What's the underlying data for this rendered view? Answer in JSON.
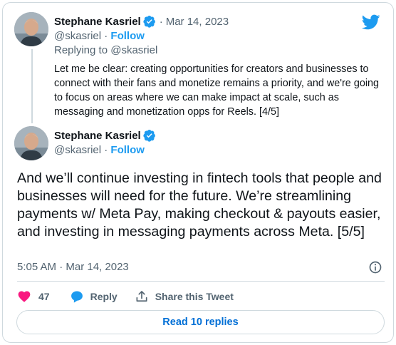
{
  "colors": {
    "accent": "#1d9bf0",
    "text": "#0f1419",
    "secondary": "#536471",
    "like": "#f91880",
    "border": "#cfd9de",
    "link_button": "#006fd6"
  },
  "icons": {
    "brand": "twitter-bird-icon",
    "verified": "verified-badge-icon",
    "info": "info-icon",
    "like": "heart-icon",
    "reply": "speech-bubble-icon",
    "share": "share-arrow-icon"
  },
  "quoted_tweet": {
    "author_name": "Stephane Kasriel",
    "date": "Mar 14, 2023",
    "dot": "·",
    "handle": "@skasriel",
    "separator": "·",
    "follow_label": "Follow",
    "replying_prefix": "Replying to",
    "replying_handle": "@skasriel",
    "text": "Let me be clear: creating opportunities for creators and businesses to connect with their fans and monetize remains a priority, and we're going to focus on areas where we can make impact at scale, such as messaging and monetization opps for Reels. [4/5]"
  },
  "tweet": {
    "author_name": "Stephane Kasriel",
    "handle": "@skasriel",
    "separator": "·",
    "follow_label": "Follow",
    "text": "And we’ll continue investing in fintech tools that people and businesses will need for the future. We’re streamlining payments w/ Meta Pay, making checkout & payouts easier, and investing in messaging payments across Meta. [5/5]",
    "timestamp": "5:05 AM · Mar 14, 2023",
    "likes": "47",
    "reply_label": "Reply",
    "share_label": "Share this Tweet",
    "read_replies_label": "Read 10 replies"
  }
}
